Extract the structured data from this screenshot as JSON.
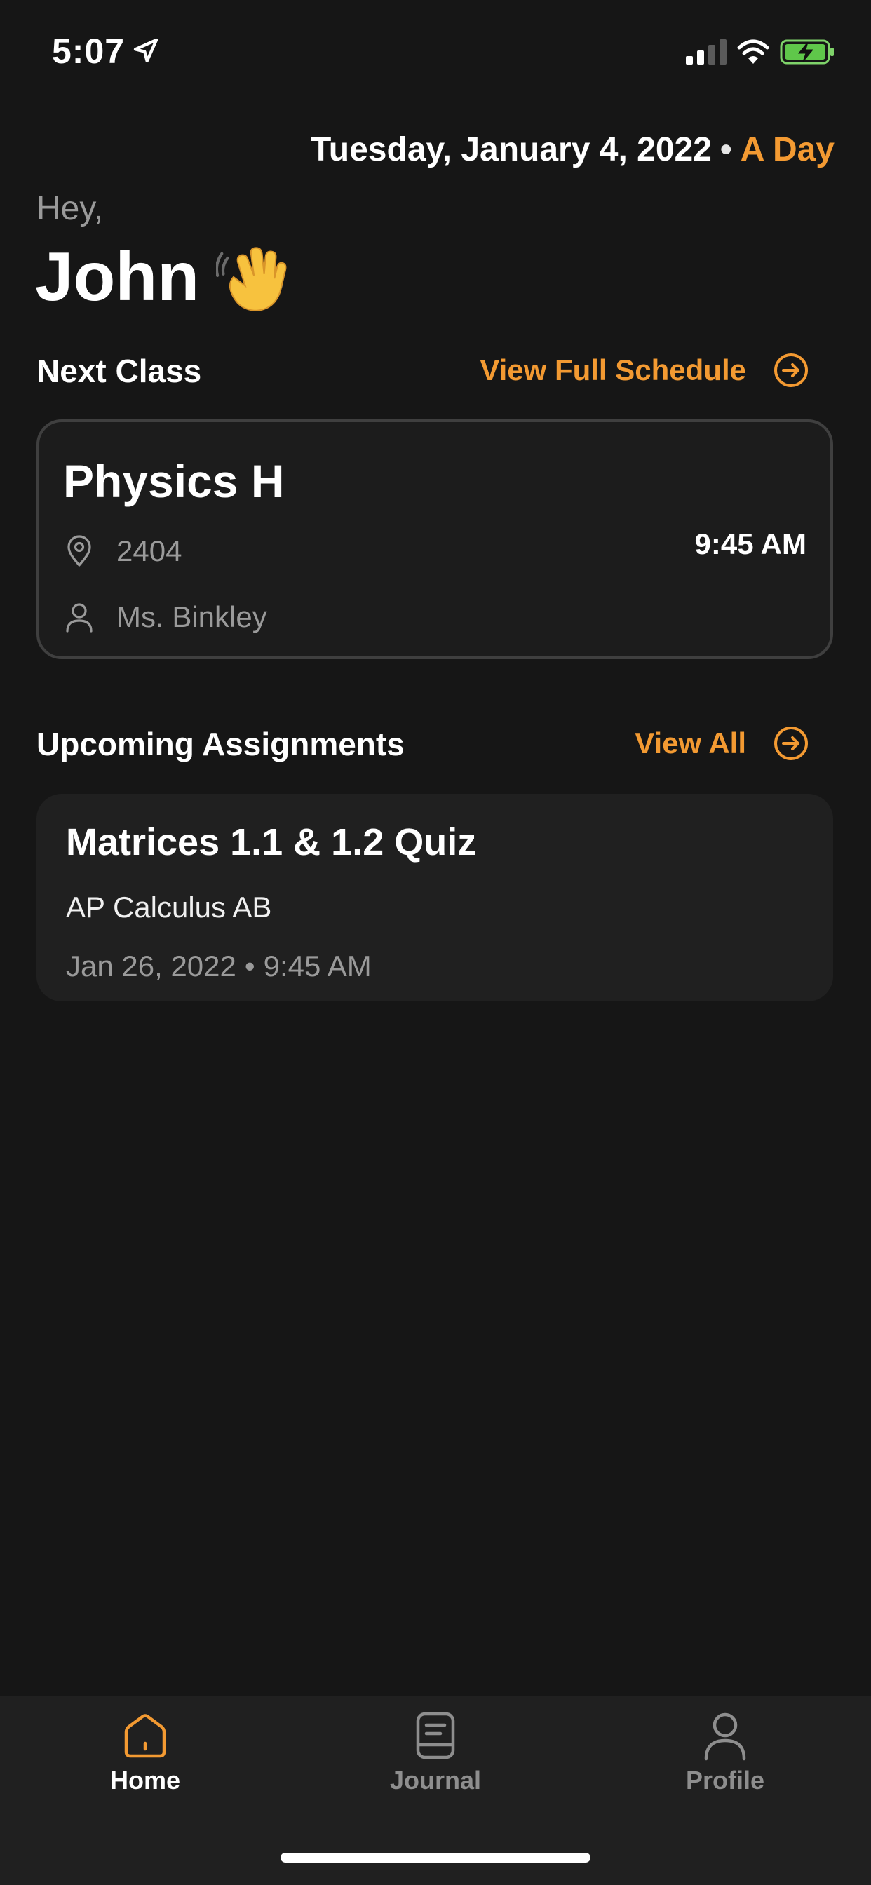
{
  "status_bar": {
    "time": "5:07"
  },
  "header": {
    "date": "Tuesday, January 4, 2022",
    "separator": "•",
    "day_type": "A Day",
    "greeting": "Hey,",
    "name": "John"
  },
  "next_class": {
    "section_title": "Next Class",
    "link_label": "View Full Schedule",
    "class_name": "Physics H",
    "room": "2404",
    "teacher": "Ms. Binkley",
    "time": "9:45 AM"
  },
  "assignments": {
    "section_title": "Upcoming Assignments",
    "link_label": "View All",
    "items": [
      {
        "title": "Matrices 1.1 & 1.2 Quiz",
        "course": "AP Calculus AB",
        "date": "Jan 26, 2022",
        "separator": "•",
        "time": "9:45 AM"
      }
    ]
  },
  "tab_bar": {
    "tabs": [
      {
        "label": "Home",
        "icon": "home-icon",
        "active": true
      },
      {
        "label": "Journal",
        "icon": "journal-icon",
        "active": false
      },
      {
        "label": "Profile",
        "icon": "profile-icon",
        "active": false
      }
    ]
  },
  "colors": {
    "accent": "#F39A32",
    "background": "#161616",
    "card": "#202020",
    "muted_text": "#9a9a9a"
  }
}
